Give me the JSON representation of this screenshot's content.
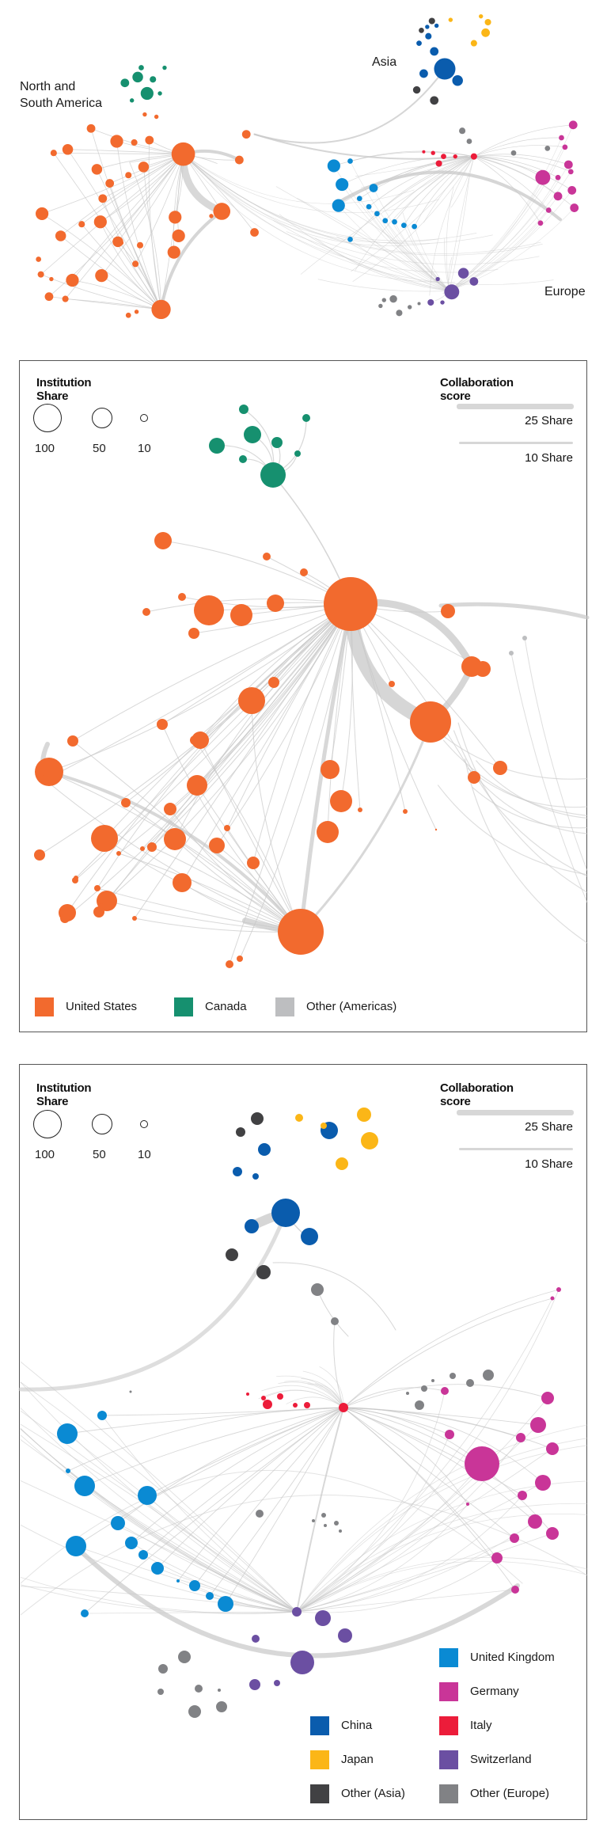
{
  "overview": {
    "labels": {
      "americas_line1": "North and",
      "americas_line2": "South America",
      "asia": "Asia",
      "europe": "Europe"
    }
  },
  "legend_common": {
    "size_title": "Institution Share",
    "size_values": [
      "100",
      "50",
      "10"
    ],
    "collab_title": "Collaboration score",
    "collab_values": [
      "25 Share",
      "10 Share"
    ]
  },
  "panel_americas": {
    "categories": [
      {
        "name": "United States",
        "color": "#f26a2e"
      },
      {
        "name": "Canada",
        "color": "#16906f"
      },
      {
        "name": "Other (Americas)",
        "color": "#bdbec0"
      }
    ]
  },
  "panel_europe_asia": {
    "categories_left": [
      {
        "name": "China",
        "color": "#0a5cad"
      },
      {
        "name": "Japan",
        "color": "#fbb617"
      },
      {
        "name": "Other (Asia)",
        "color": "#414143"
      }
    ],
    "categories_right": [
      {
        "name": "United Kingdom",
        "color": "#0a8ad3"
      },
      {
        "name": "Germany",
        "color": "#c93598"
      },
      {
        "name": "Italy",
        "color": "#ec1c3a"
      },
      {
        "name": "Switzerland",
        "color": "#6b4fa2"
      },
      {
        "name": "Other (Europe)",
        "color": "#818285"
      }
    ]
  },
  "colors": {
    "us": "#f26a2e",
    "ca": "#16906f",
    "oa": "#bdbec0",
    "cn": "#0a5cad",
    "jp": "#fbb617",
    "oas": "#414143",
    "uk": "#0a8ad3",
    "de": "#c93598",
    "it": "#ec1c3a",
    "ch": "#6b4fa2",
    "oe": "#818285",
    "edge": "#c8c8c8"
  }
}
